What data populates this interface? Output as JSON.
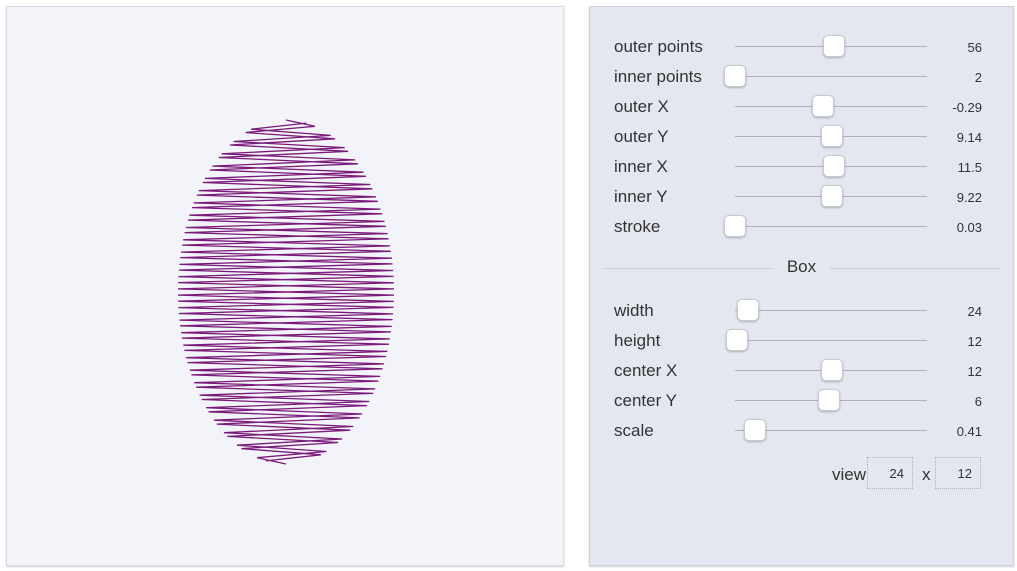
{
  "pattern": {
    "stroke_color": "#7a1a7a",
    "outer_points": 56,
    "inner_points": 2,
    "outer_x": -0.29,
    "outer_y": 9.14,
    "inner_x": 11.5,
    "inner_y": 9.22,
    "stroke": 0.03
  },
  "controls": {
    "sliders": [
      {
        "label": "outer points",
        "value": "56",
        "fraction": 0.55
      },
      {
        "label": "inner points",
        "value": "2",
        "fraction": 0.0
      },
      {
        "label": "outer X",
        "value": "-0.29",
        "fraction": 0.49
      },
      {
        "label": "outer Y",
        "value": "9.14",
        "fraction": 0.54
      },
      {
        "label": "inner X",
        "value": "11.5",
        "fraction": 0.55
      },
      {
        "label": "inner Y",
        "value": "9.22",
        "fraction": 0.54
      },
      {
        "label": "stroke",
        "value": "0.03",
        "fraction": 0.0
      }
    ],
    "box_section_title": "Box",
    "box_sliders": [
      {
        "label": "width",
        "value": "24",
        "fraction": 0.07
      },
      {
        "label": "height",
        "value": "12",
        "fraction": 0.01
      },
      {
        "label": "center X",
        "value": "12",
        "fraction": 0.54
      },
      {
        "label": "center Y",
        "value": "6",
        "fraction": 0.52
      },
      {
        "label": "scale",
        "value": "0.41",
        "fraction": 0.11
      }
    ],
    "view_box": {
      "label": "view box",
      "separator": "x",
      "width": "24",
      "height": "12"
    }
  }
}
